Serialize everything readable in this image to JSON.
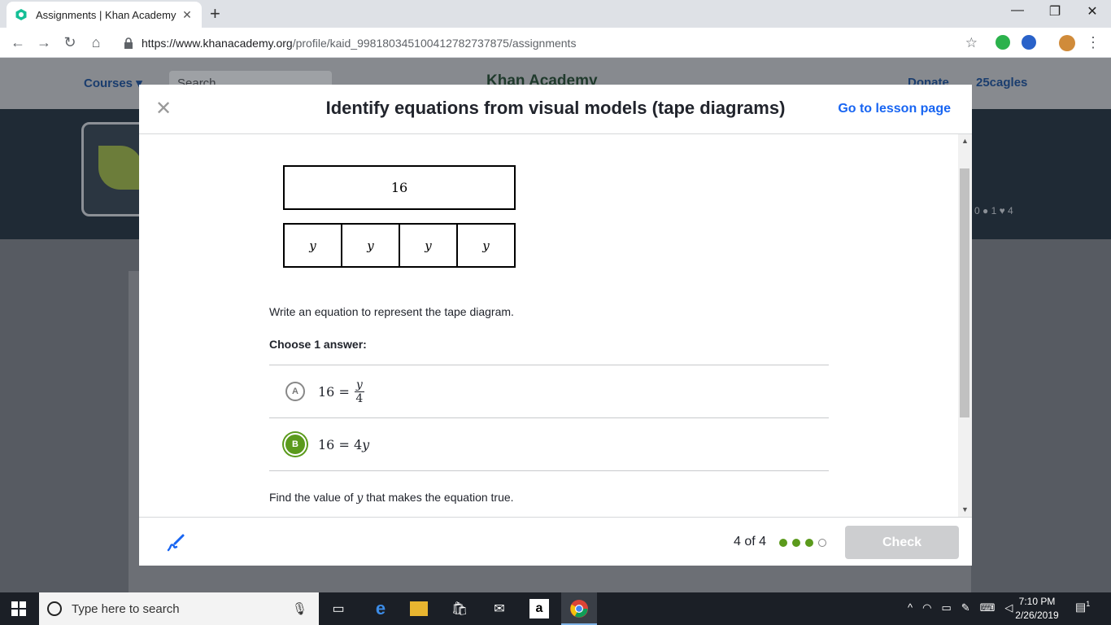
{
  "browser": {
    "tab_title": "Assignments | Khan Academy",
    "tab_close": "✕",
    "new_tab": "+",
    "url_host": "https://www.khanacademy.org",
    "url_path": "/profile/kaid_998180345100412782737875/assignments",
    "window_controls": [
      "—",
      "❐",
      "✕"
    ]
  },
  "background_page": {
    "nav_courses": "Courses ▾",
    "nav_search": "Search",
    "nav_logo": "Khan Academy",
    "nav_donate": "Donate",
    "nav_user": "25cagles",
    "stats": "0 ● 1 ♥ 4"
  },
  "modal": {
    "close_glyph": "✕",
    "title": "Identify equations from visual models (tape diagrams)",
    "lesson_link": "Go to lesson page",
    "tape_total": "16",
    "tape_parts": [
      "y",
      "y",
      "y",
      "y"
    ],
    "prompt": "Write an equation to represent the tape diagram.",
    "choose_label": "Choose 1 answer:",
    "choices": [
      {
        "letter": "A",
        "lhs": "16 =",
        "frac_num": "y",
        "frac_den": "4",
        "selected": false
      },
      {
        "letter": "B",
        "lhs": "16 =",
        "rhs": "4",
        "var": "y",
        "selected": true
      }
    ],
    "find_prefix": "Find the value of ",
    "find_var": "y",
    "find_suffix": " that makes the equation true.",
    "progress_text": "4 of 4",
    "progress_dots": [
      true,
      true,
      true,
      false
    ],
    "check_label": "Check"
  },
  "taskbar": {
    "search_placeholder": "Type here to search",
    "time": "7:10 PM",
    "date": "2/26/2019",
    "notifications": "1"
  },
  "colors": {
    "accent_blue": "#1865f2",
    "correct_green": "#5b9a1c",
    "check_disabled": "#cdced0"
  }
}
